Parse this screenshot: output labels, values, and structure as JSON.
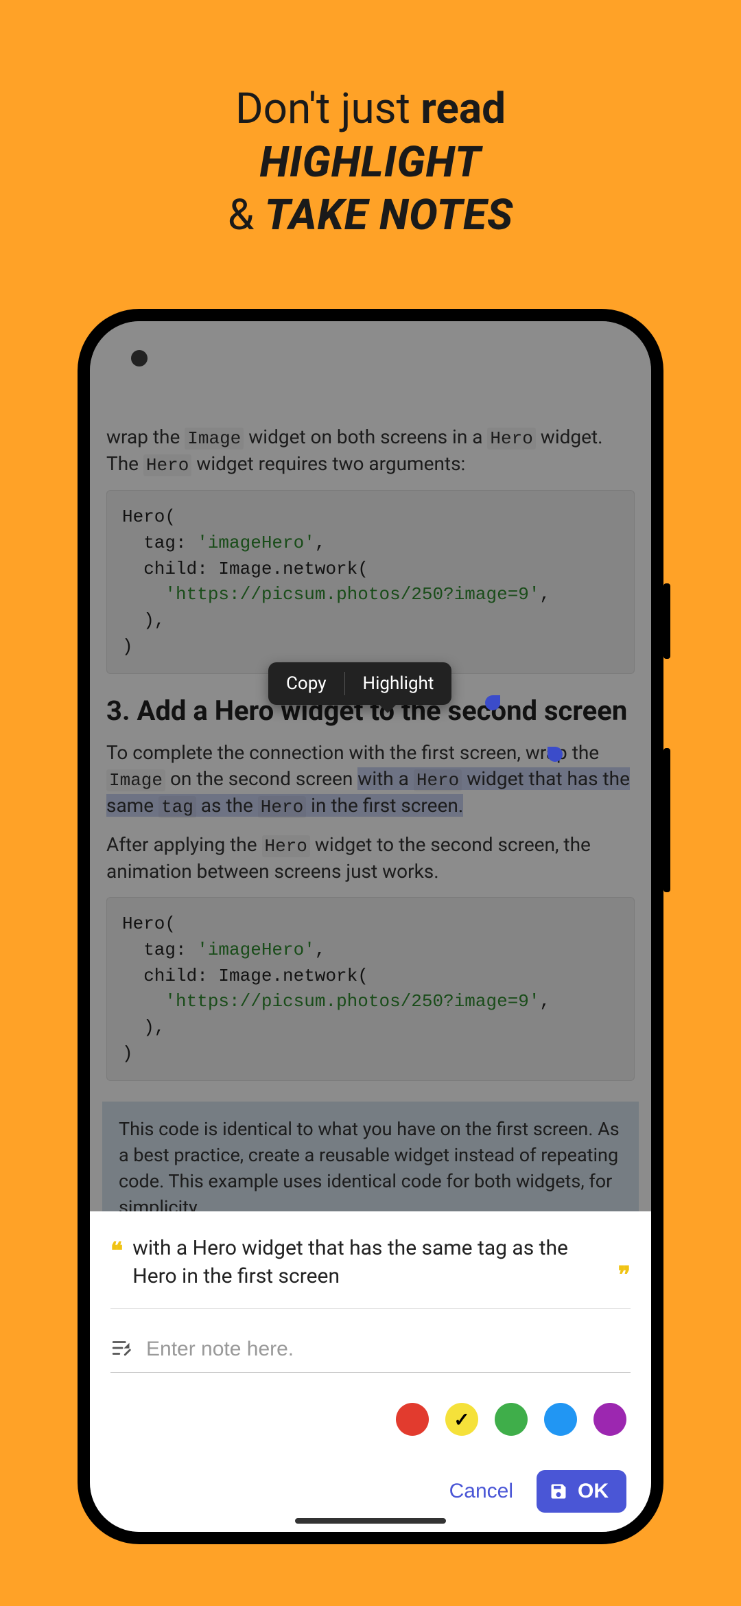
{
  "promo": {
    "line1_pre": "Don't just ",
    "line1_bold": "read",
    "line2": "HIGHLIGHT",
    "line3_amp": "& ",
    "line3_em": "TAKE NOTES"
  },
  "article": {
    "intro_pre": "wrap the ",
    "intro_code1": "Image",
    "intro_mid": " widget on both screens in a ",
    "intro_code2": "Hero",
    "intro_post": " widget. The ",
    "intro_code3": "Hero",
    "intro_end": " widget requires two arguments:",
    "code1_l1": "Hero(",
    "code1_l2": "  tag: ",
    "code1_l2s": "'imageHero'",
    "code1_l2e": ",",
    "code1_l3": "  child: Image.network(",
    "code1_l4": "    ",
    "code1_l4s": "'https://picsum.photos/250?image=9'",
    "code1_l4e": ",",
    "code1_l5": "  ),",
    "code1_l6": ")",
    "h2": "3. Add a Hero widget to the second screen",
    "p2_pre": "To complete the connection with the first screen, wrap the ",
    "p2_c1": "Image",
    "p2_mid": " on the second screen ",
    "p2_sel": "with a ",
    "p2_sel_c": "Hero",
    "p2_sel2": " widget that has the same ",
    "p2_sel_c2": "tag",
    "p2_sel3": " as the ",
    "p2_sel_c3": "Hero",
    "p2_sel4": " in the first screen.",
    "p3_pre": "After applying the ",
    "p3_c1": "Hero",
    "p3_post": " widget to the second screen, the animation between screens just works.",
    "info": "This code is identical to what you have on the first screen. As a best practice, create a reusable widget instead of repeating code. This example uses identical code for both widgets, for simplicity."
  },
  "context_menu": {
    "copy": "Copy",
    "highlight": "Highlight"
  },
  "note_panel": {
    "quote": "with a Hero widget that has the same tag as the Hero in the first screen",
    "placeholder": "Enter note here.",
    "cancel": "Cancel",
    "ok": "OK",
    "colors": [
      {
        "name": "red",
        "hex": "#e23b2e",
        "selected": false
      },
      {
        "name": "yellow",
        "hex": "#f5e13a",
        "selected": true
      },
      {
        "name": "green",
        "hex": "#3fae4a",
        "selected": false
      },
      {
        "name": "blue",
        "hex": "#2196f3",
        "selected": false
      },
      {
        "name": "purple",
        "hex": "#9c27b0",
        "selected": false
      }
    ]
  }
}
